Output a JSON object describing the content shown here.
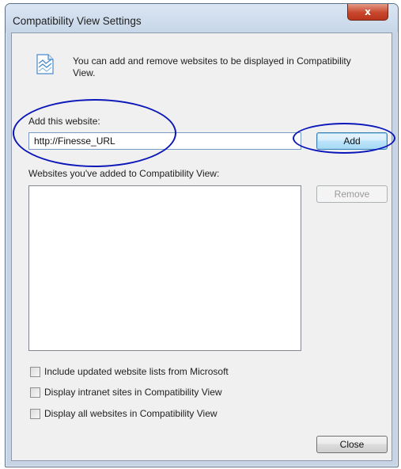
{
  "window": {
    "title": "Compatibility View Settings",
    "close_glyph": "x"
  },
  "info": {
    "icon": "webpage-compatibility-icon",
    "text": "You can add and remove websites to be displayed in Compatibility View."
  },
  "add_section": {
    "label": "Add this website:",
    "input_value": "http://Finesse_URL",
    "add_button_label": "Add"
  },
  "list_section": {
    "label": "Websites you've added to Compatibility View:",
    "items": [],
    "remove_button_label": "Remove"
  },
  "options": {
    "include_updated_lists": "Include updated website lists from Microsoft",
    "display_intranet": "Display intranet sites in Compatibility View",
    "display_all": "Display all websites in Compatibility View"
  },
  "footer": {
    "close_button_label": "Close"
  },
  "colors": {
    "annotation": "#0b17b8",
    "dialog_background": "#f0f0f0",
    "close_button_red": "#c8462c"
  }
}
